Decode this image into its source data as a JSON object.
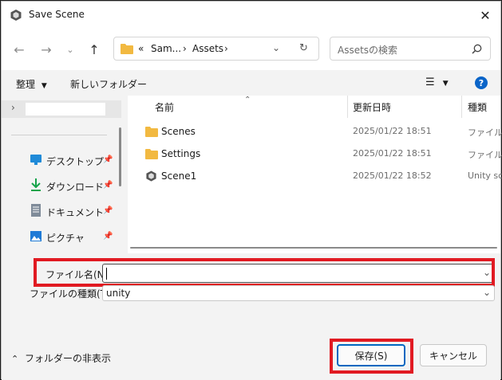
{
  "window": {
    "title": "Save Scene",
    "close_glyph": "✕"
  },
  "nav": {
    "address_parts": [
      "«",
      "Sam...",
      "›",
      "Assets",
      "›"
    ],
    "search_placeholder": "Assetsの検索"
  },
  "toolbar": {
    "organize": "整理",
    "new_folder": "新しいフォルダー"
  },
  "sidebar": {
    "items": [
      {
        "label": "デスクトップ",
        "icon": "desktop-icon"
      },
      {
        "label": "ダウンロード",
        "icon": "download-icon"
      },
      {
        "label": "ドキュメント",
        "icon": "document-icon"
      },
      {
        "label": "ピクチャ",
        "icon": "pictures-icon"
      }
    ]
  },
  "columns": {
    "name": "名前",
    "date": "更新日時",
    "type": "種類"
  },
  "files": [
    {
      "name": "Scenes",
      "date": "2025/01/22 18:51",
      "type": "ファイル フ",
      "icon": "folder-icon"
    },
    {
      "name": "Settings",
      "date": "2025/01/22 18:51",
      "type": "ファイル フ",
      "icon": "folder-icon"
    },
    {
      "name": "Scene1",
      "date": "2025/01/22 18:52",
      "type": "Unity sc",
      "icon": "unity-icon"
    }
  ],
  "form": {
    "filename_label": "ファイル名(N):",
    "filename_value": "",
    "filetype_label": "ファイルの種類(T):",
    "filetype_value": "unity"
  },
  "footer": {
    "hide_folders": "フォルダーの非表示",
    "save": "保存(S)",
    "cancel": "キャンセル"
  },
  "colors": {
    "highlight": "#e11a22",
    "folder": "#f2b941",
    "help": "#0a64c8"
  }
}
